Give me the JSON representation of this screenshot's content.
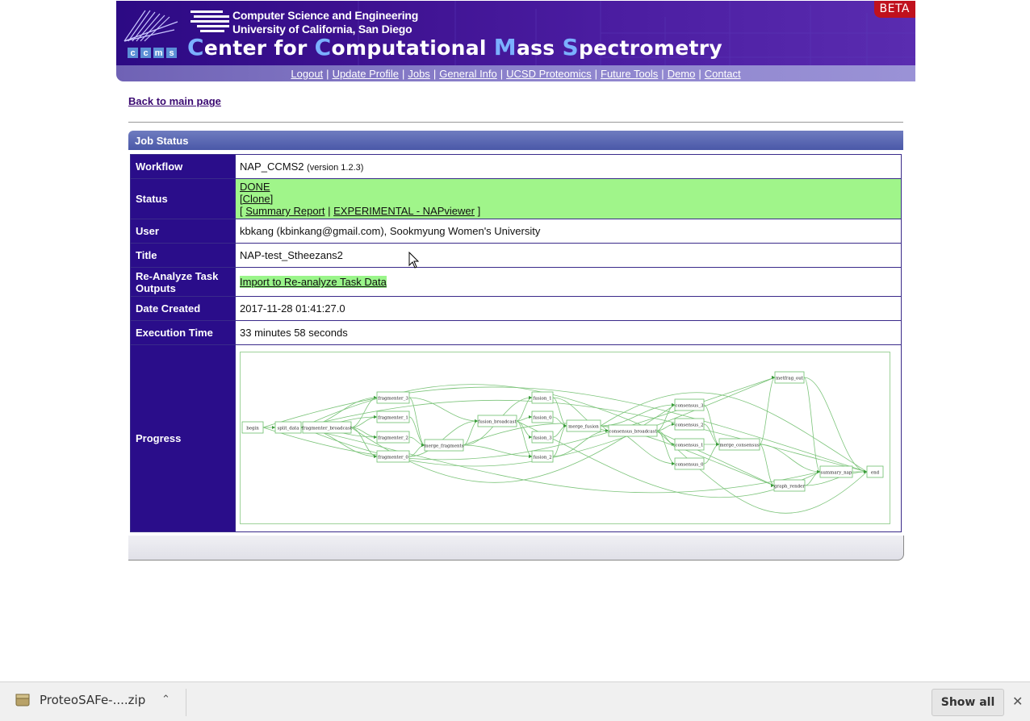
{
  "header": {
    "dept_line1": "Computer Science and Engineering",
    "dept_line2": "University of California, San Diego",
    "title_parts": [
      "C",
      "enter for ",
      "C",
      "omputational ",
      "M",
      "ass ",
      "S",
      "pectrometry"
    ],
    "logo_letters": [
      "c",
      "c",
      "m",
      "s"
    ],
    "beta": "BETA"
  },
  "nav": {
    "items": [
      "Logout",
      "Update Profile",
      "Jobs",
      "General Info",
      "UCSD Proteomics",
      "Future Tools",
      "Demo",
      "Contact"
    ],
    "separator": "|"
  },
  "back_link": "Back to main page",
  "panel": {
    "title": "Job Status"
  },
  "job": {
    "workflow_label": "Workflow",
    "workflow_value": "NAP_CCMS2",
    "workflow_version": "(version 1.2.3)",
    "status_label": "Status",
    "status_done": "DONE",
    "status_clone": "[Clone]",
    "status_open_bracket": "[",
    "status_summary": "Summary Report",
    "status_pipe": "|",
    "status_napviewer": "EXPERIMENTAL - NAPviewer",
    "status_close_bracket": "]",
    "user_label": "User",
    "user_value": "kbkang (kbinkang@gmail.com), Sookmyung Women's University",
    "title_label": "Title",
    "title_value": "NAP-test_Stheezans2",
    "reanalyze_label": "Re-Analyze Task Outputs",
    "reanalyze_value": "Import to Re-analyze Task Data",
    "date_label": "Date Created",
    "date_value": "2017-11-28 01:41:27.0",
    "exec_label": "Execution Time",
    "exec_value": "33 minutes 58 seconds",
    "progress_label": "Progress"
  },
  "graph_nodes": [
    "begin",
    "split_data",
    "fragmenter_broadcast",
    "fragmenter_3",
    "fragmenter_1",
    "fragmenter_2",
    "fragmenter_0",
    "merge_fragments",
    "fusion_broadcast",
    "fusion_1",
    "fusion_0",
    "fusion_3",
    "fusion_2",
    "merge_fusion",
    "consensus_broadcast",
    "consensus_3",
    "consensus_2",
    "consensus_1",
    "consensus_0",
    "merge_consensus",
    "metfrag_out",
    "graph_render",
    "summary_nap",
    "end"
  ],
  "download_bar": {
    "file_name": "ProteoSAFe-....zip",
    "show_all": "Show all"
  },
  "colors": {
    "header_purple": "#3d1190",
    "label_purple": "#2a0d8a",
    "status_green": "#a0f58a",
    "beta_red": "#c0111d",
    "graph_green": "#7cc47a"
  }
}
